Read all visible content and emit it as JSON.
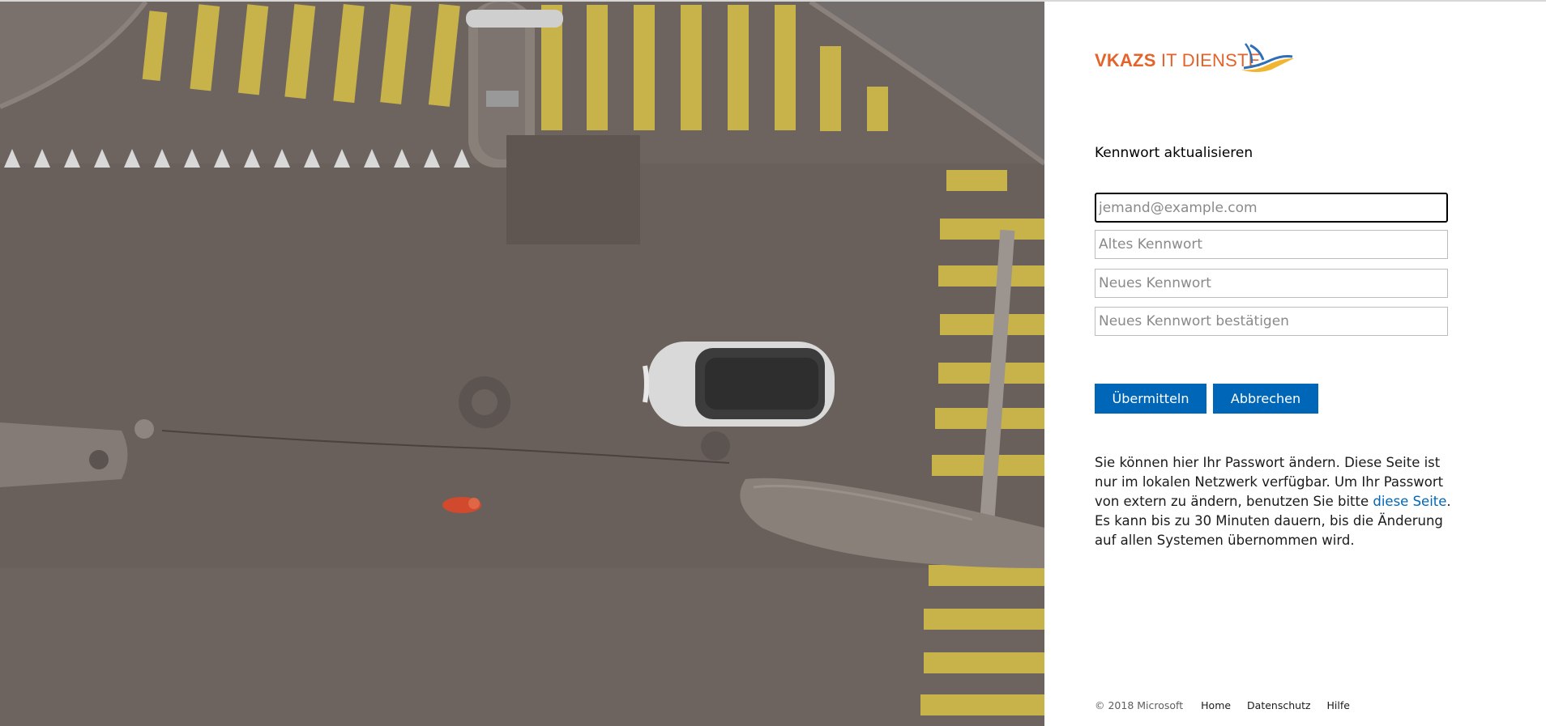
{
  "logo": {
    "brand_bold": "VKAZS",
    "brand_rest": " IT DIENSTE",
    "brand_color": "#e4632a"
  },
  "illustration": {
    "description_icon": "aerial-street-crossing-image"
  },
  "form": {
    "heading": "Kennwort aktualisieren",
    "email_placeholder": "jemand@example.com",
    "email_value": "",
    "old_password_placeholder": "Altes Kennwort",
    "new_password_placeholder": "Neues Kennwort",
    "confirm_password_placeholder": "Neues Kennwort bestätigen",
    "submit_label": "Übermitteln",
    "cancel_label": "Abbrechen"
  },
  "info": {
    "text_before_link": "Sie können hier Ihr Passwort ändern. Diese Seite ist nur im lokalen Netzwerk verfügbar. Um Ihr Passwort von extern zu ändern, benutzen Sie bitte ",
    "link_text": "diese Seite",
    "text_after_link": ".",
    "second_line": "Es kann bis zu 30 Minuten dauern, bis die Änderung auf allen Systemen übernommen wird."
  },
  "footer": {
    "copyright": "© 2018 Microsoft",
    "home": "Home",
    "privacy": "Datenschutz",
    "help": "Hilfe"
  },
  "colors": {
    "accent": "#0067b8",
    "link": "#0067b8"
  }
}
